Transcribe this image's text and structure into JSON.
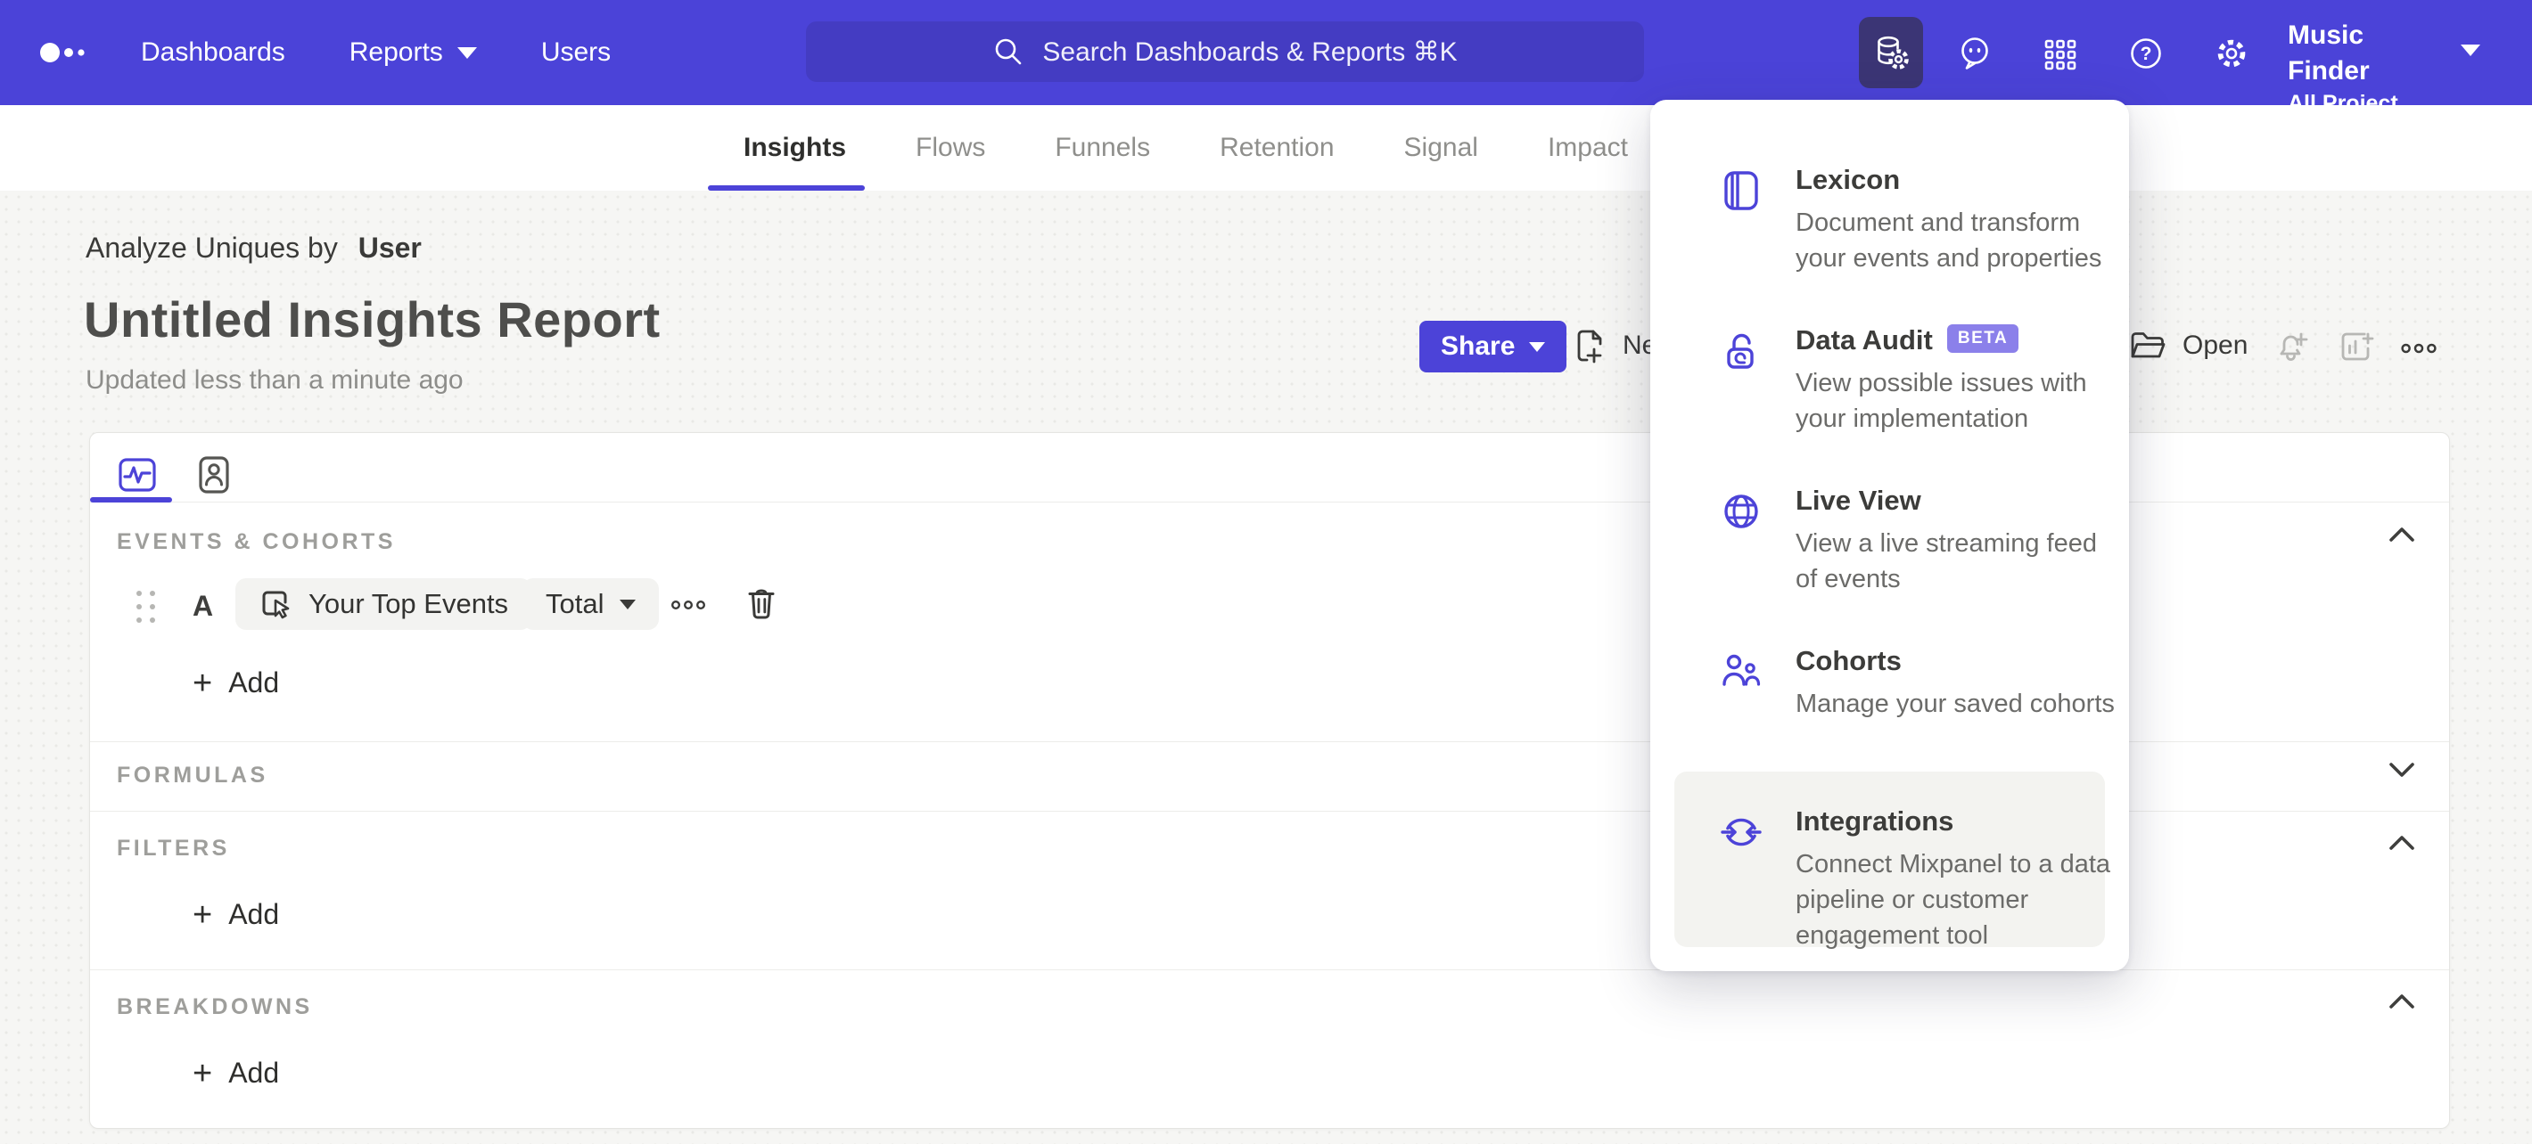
{
  "colors": {
    "accent": "#4c43d8",
    "nav_bg": "#4b43d8",
    "search_bg": "#443cc2",
    "active_tile_bg": "#3b3575",
    "beta_badge_bg": "#8b80ea",
    "page_bg": "#f6f6f4"
  },
  "nav": {
    "logo_icon": "mixpanel-dots-logo",
    "items": [
      {
        "label": "Dashboards"
      },
      {
        "label": "Reports",
        "has_caret": true
      },
      {
        "label": "Users"
      }
    ],
    "search": {
      "placeholder": "Search Dashboards & Reports ⌘K",
      "icon": "search-icon"
    },
    "icons": [
      "data-management-icon",
      "feedback-bubble-icon",
      "apps-grid-icon",
      "help-icon",
      "settings-gear-icon"
    ],
    "project": {
      "name": "Music Finder",
      "scope": "All Project Data"
    }
  },
  "tabs": {
    "active": "Insights",
    "items": [
      {
        "label": "Insights"
      },
      {
        "label": "Flows"
      },
      {
        "label": "Funnels"
      },
      {
        "label": "Retention"
      },
      {
        "label": "Signal"
      },
      {
        "label": "Impact"
      }
    ]
  },
  "report": {
    "analyze_label": "Analyze Uniques by",
    "analyze_value": "User",
    "title": "Untitled Insights Report",
    "updated": "Updated less than a minute ago",
    "share_label": "Share",
    "new_label": "New",
    "open_label": "Open",
    "more_icon": "more-ellipsis-icon",
    "disabled_icons": [
      "bell-add-icon",
      "board-add-icon"
    ]
  },
  "builder": {
    "tab_icons": [
      "pulse-chart-tab-icon",
      "profile-tab-icon"
    ],
    "sections": [
      {
        "label": "EVENTS & COHORTS",
        "chevron": "up"
      },
      {
        "label": "FORMULAS",
        "chevron": "down"
      },
      {
        "label": "FILTERS",
        "chevron": "up",
        "add_label": "Add"
      },
      {
        "label": "BREAKDOWNS",
        "chevron": "up",
        "add_label": "Add"
      }
    ],
    "event_row": {
      "series_letter": "A",
      "event_label": "Your Top Events",
      "event_icon": "event-click-icon",
      "metric_label": "Total",
      "row_icons": [
        "drag-handle",
        "more-ellipsis-icon",
        "trash-icon"
      ]
    },
    "events_add_label": "Add"
  },
  "menu": {
    "items": [
      {
        "title": "Lexicon",
        "desc": "Document and transform your events and properties",
        "icon": "lexicon-book-icon"
      },
      {
        "title": "Data Audit",
        "badge": "BETA",
        "desc": "View possible issues with your implementation",
        "icon": "data-audit-lock-icon"
      },
      {
        "title": "Live View",
        "desc": "View a live streaming feed of events",
        "icon": "live-view-globe-icon"
      },
      {
        "title": "Cohorts",
        "desc": "Manage your saved cohorts",
        "icon": "cohorts-people-icon"
      },
      {
        "title": "Integrations",
        "desc": "Connect Mixpanel to a data pipeline or customer engagement tool",
        "icon": "integrations-sync-icon",
        "highlighted": true
      }
    ]
  }
}
